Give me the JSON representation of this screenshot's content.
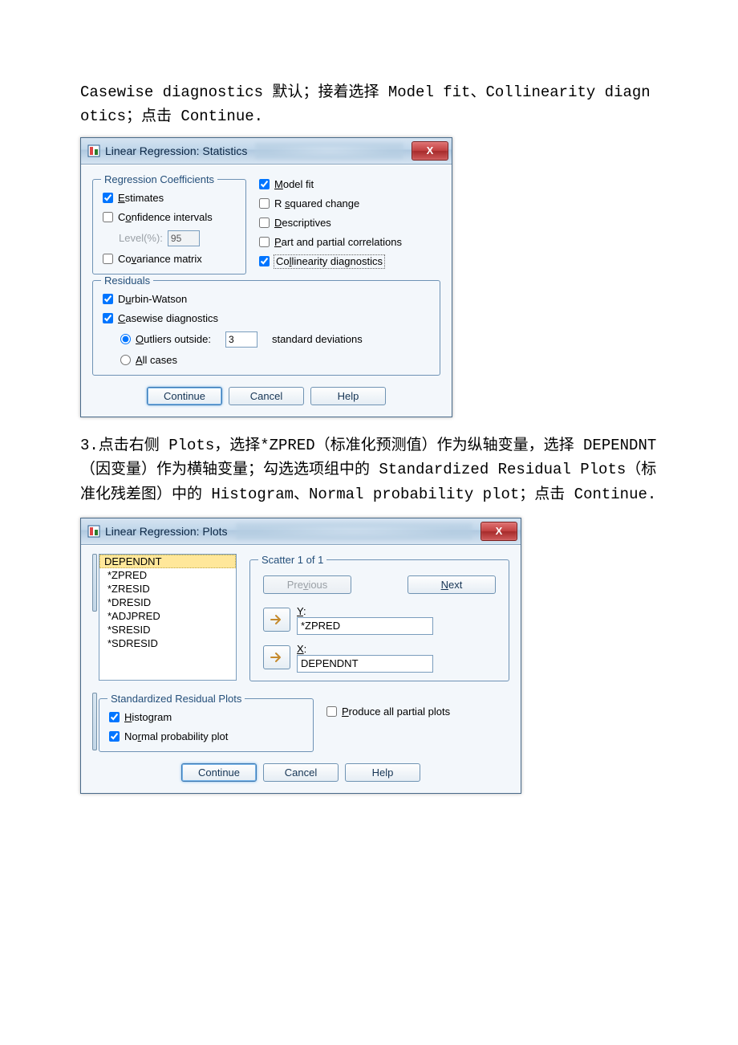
{
  "para1_a": "Casewise diagnostics 默认；接着选择 Model fit、Collinearity diagnotics；点击 Continue.",
  "dlg1": {
    "title": "Linear Regression: Statistics",
    "close": "X",
    "grp_regcoef": "Regression Coefficients",
    "estimates": "Estimates",
    "confint": "Confidence intervals",
    "level_lbl": "Level(%):",
    "level_val": "95",
    "covmat": "Covariance matrix",
    "modelfit": "Model fit",
    "r2change": "R squared change",
    "descriptives": "Descriptives",
    "partcorr": "Part and partial correlations",
    "colldiag": "Collinearity diagnostics",
    "grp_resid": "Residuals",
    "durbin": "Durbin-Watson",
    "casediag": "Casewise diagnostics",
    "outliers": "Outliers outside:",
    "sd_val": "3",
    "sd_lbl": "standard deviations",
    "allcases": "All cases",
    "btn_continue": "Continue",
    "btn_cancel": "Cancel",
    "btn_help": "Help"
  },
  "para2": "3.点击右侧 Plots，选择*ZPRED（标准化预测值）作为纵轴变量，选择 DEPENDNT（因变量）作为横轴变量；勾选选项组中的 Standardized Residual Plots（标准化残差图）中的 Histogram、Normal probability plot；点击 Continue.",
  "dlg2": {
    "title": "Linear Regression: Plots",
    "close": "X",
    "vars": [
      "DEPENDNT",
      "*ZPRED",
      "*ZRESID",
      "*DRESID",
      "*ADJPRED",
      "*SRESID",
      "*SDRESID"
    ],
    "scatter_leg": "Scatter 1 of 1",
    "prev": "Previous",
    "next": "Next",
    "y_lbl": "Y:",
    "y_val": "*ZPRED",
    "x_lbl": "X:",
    "x_val": "DEPENDNT",
    "srp_leg": "Standardized Residual Plots",
    "hist": "Histogram",
    "normprob": "Normal probability plot",
    "partialplots": "Produce all partial plots",
    "btn_continue": "Continue",
    "btn_cancel": "Cancel",
    "btn_help": "Help"
  }
}
